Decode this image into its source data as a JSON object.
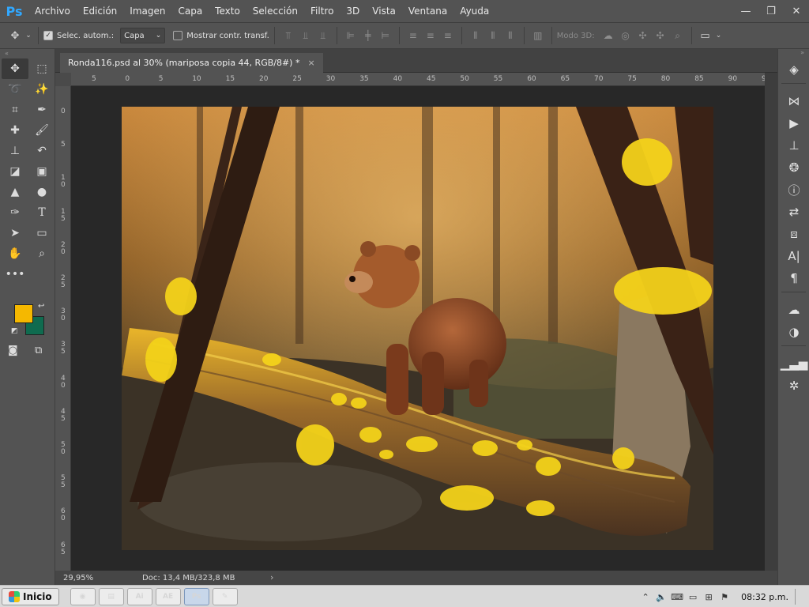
{
  "app": {
    "logo": "Ps"
  },
  "menu": [
    "Archivo",
    "Edición",
    "Imagen",
    "Capa",
    "Texto",
    "Selección",
    "Filtro",
    "3D",
    "Vista",
    "Ventana",
    "Ayuda"
  ],
  "window_controls": {
    "minimize": "—",
    "restore": "❐",
    "close": "✕"
  },
  "options": {
    "auto_select_label": "Selec. autom.:",
    "auto_select_checked": true,
    "auto_select_value": "Capa",
    "show_transform_label": "Mostrar contr. transf.",
    "show_transform_checked": false,
    "mode3d_label": "Modo 3D:"
  },
  "document": {
    "tab_title": "Ronda116.psd al 30% (mariposa copia 44, RGB/8#) *",
    "close_glyph": "×"
  },
  "rulers": {
    "horizontal": [
      "5",
      "0",
      "5",
      "10",
      "15",
      "20",
      "25",
      "30",
      "35",
      "40",
      "45",
      "50",
      "55",
      "60",
      "65",
      "70",
      "75",
      "80",
      "85",
      "90",
      "9"
    ],
    "vertical": [
      "0",
      "5",
      "1 0",
      "1 5",
      "2 0",
      "2 5",
      "3 0",
      "3 5",
      "4 0",
      "4 5",
      "5 0",
      "5 5",
      "6 0",
      "6 5"
    ]
  },
  "status": {
    "zoom": "29,95%",
    "doc_size": "Doc: 13,4 MB/323,8 MB",
    "arrow": "›"
  },
  "colors": {
    "foreground": "#f5b800",
    "background": "#0f6b4f",
    "accent": "#31a8ff"
  },
  "tools": [
    "move-tool",
    "marquee-tool",
    "lasso-tool",
    "magic-wand-tool",
    "crop-tool",
    "eyedropper-tool",
    "healing-brush-tool",
    "brush-tool",
    "stamp-tool",
    "history-brush-tool",
    "eraser-tool",
    "gradient-tool",
    "blur-tool",
    "dodge-tool",
    "pen-tool",
    "type-tool",
    "path-select-tool",
    "rectangle-tool",
    "hand-tool",
    "zoom-tool"
  ],
  "right_panel_icons": [
    "layers-icon",
    "paths-icon",
    "actions-icon",
    "clone-source-icon",
    "channels-icon",
    "info-icon",
    "history-icon",
    "3d-icon",
    "character-icon",
    "paragraph-icon",
    "libraries-icon",
    "adjustments-icon",
    "histogram-icon",
    "properties-icon"
  ],
  "taskbar": {
    "start_label": "Inicio",
    "apps": [
      {
        "name": "chrome",
        "glyph": "◉"
      },
      {
        "name": "explorer",
        "glyph": "▤"
      },
      {
        "name": "illustrator",
        "glyph": "Ai"
      },
      {
        "name": "after-effects",
        "glyph": "AE"
      },
      {
        "name": "photoshop",
        "glyph": "Ps"
      },
      {
        "name": "paint",
        "glyph": "✎"
      }
    ],
    "clock": "08:32 p.m."
  }
}
